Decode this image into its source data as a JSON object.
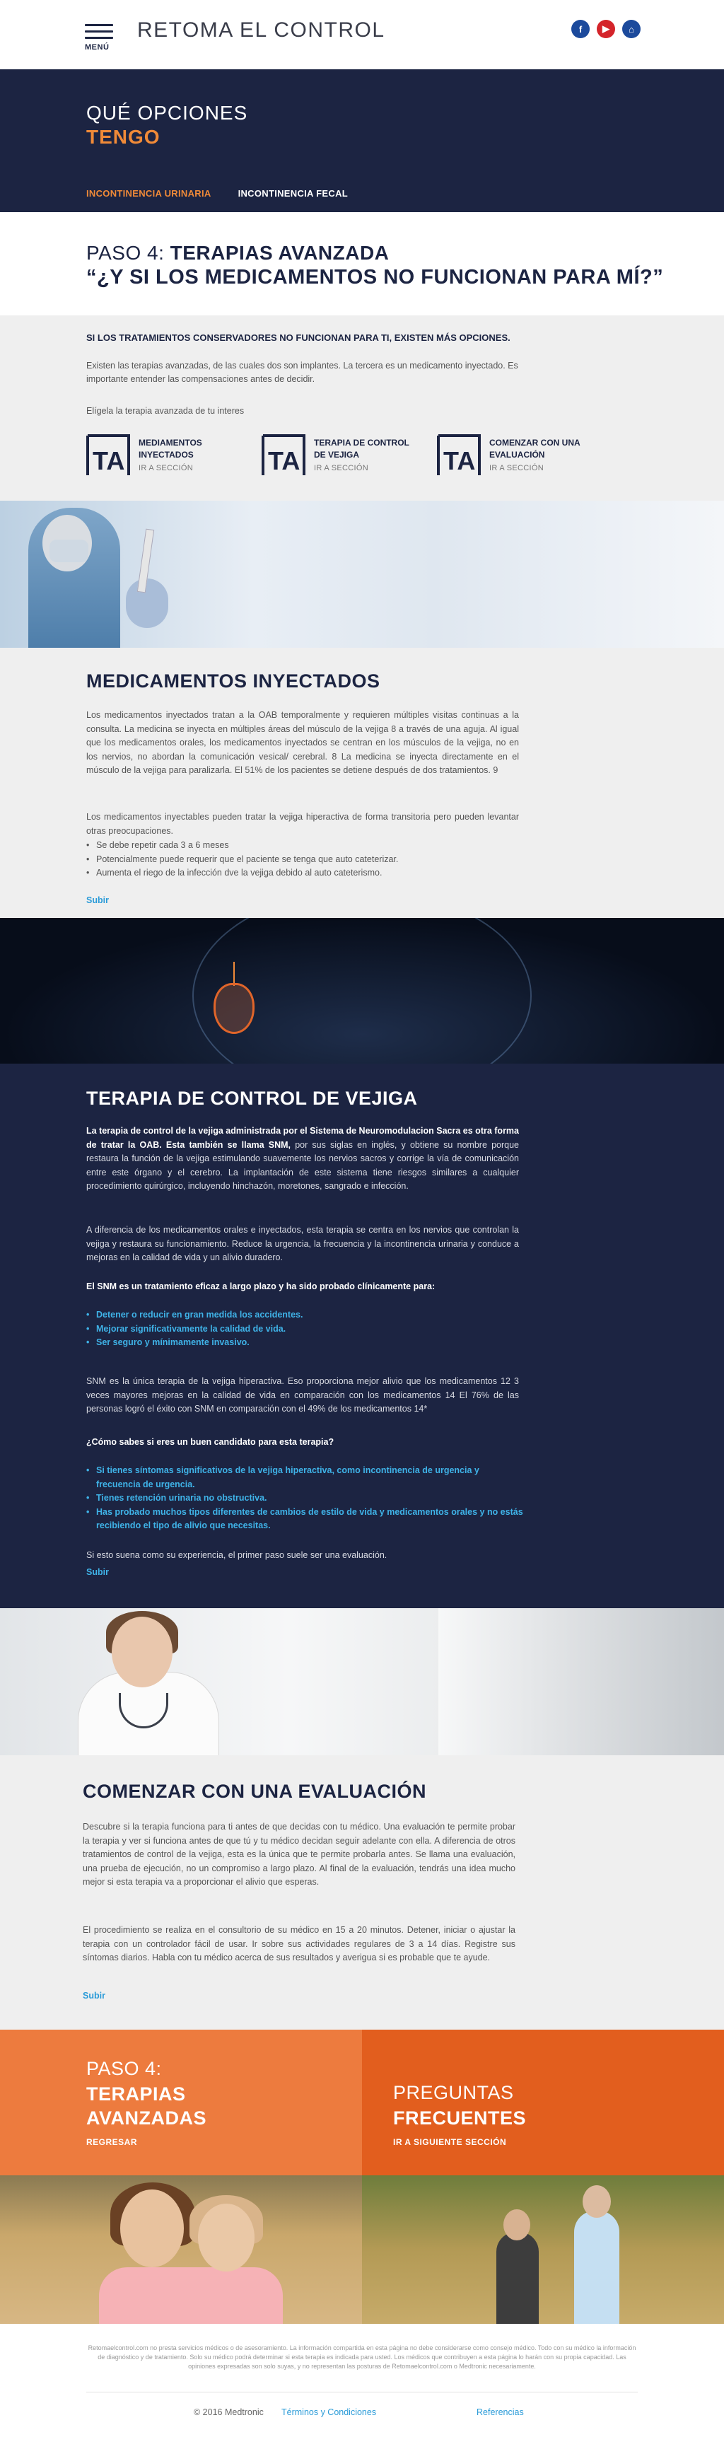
{
  "header": {
    "menu_label": "MENÚ",
    "site_title": "RETOMA EL CONTROL",
    "social": [
      {
        "icon": "facebook-icon",
        "glyph": "f"
      },
      {
        "icon": "youtube-icon",
        "glyph": "▶"
      },
      {
        "icon": "home-icon",
        "glyph": "⌂"
      }
    ]
  },
  "hero": {
    "line1": "QUÉ OPCIONES",
    "line2": "TENGO",
    "tabs": [
      {
        "label": "INCONTINENCIA URINARIA",
        "active": true
      },
      {
        "label": "INCONTINENCIA FECAL",
        "active": false
      }
    ]
  },
  "step": {
    "prefix": "PASO 4:",
    "title": "TERAPIAS AVANZADA",
    "question": "“¿Y SI LOS MEDICAMENTOS NO FUNCIONAN PARA MÍ?”"
  },
  "intro": {
    "heading": "SI LOS TRATAMIENTOS CONSERVADORES NO FUNCIONAN PARA TI, EXISTEN MÁS OPCIONES.",
    "body": "Existen las terapias avanzadas, de las cuales dos son implantes. La tercera es un medicamento inyectado. Es importante entender las compensaciones antes de decidir.",
    "pick": "Elígela la terapia avanzada de tu interes",
    "options": [
      {
        "logo": "TA",
        "title": "MEDIAMENTOS INYECTADOS",
        "link": "IR A SECCIÓN"
      },
      {
        "logo": "TA",
        "title": "TERAPIA DE CONTROL DE VEJIGA",
        "link": "IR A SECCIÓN"
      },
      {
        "logo": "TA",
        "title": "COMENZAR CON UNA EVALUACIÓN",
        "link": "IR A SECCIÓN"
      }
    ]
  },
  "med": {
    "title": "MEDICAMENTOS INYECTADOS",
    "p1": "Los medicamentos inyectados tratan a la OAB temporalmente y requieren múltiples visitas continuas a la consulta. La medicina se inyecta en múltiples áreas del músculo de la vejiga 8 a través de una aguja. Al igual que los medicamentos orales, los medicamentos inyectados se centran en los músculos de la vejiga, no en los nervios, no abordan la comunicación vesical/ cerebral. 8 La medicina se inyecta directamente en el músculo de la vejiga para paralizarla. El 51% de los pacientes se detiene después de dos tratamientos. 9",
    "p2": "Los medicamentos inyectables pueden tratar la vejiga hiperactiva de forma transitoria pero pueden levantar otras preocupaciones.",
    "bullets": [
      "Se debe repetir cada 3 a 6 meses",
      "Potencialmente puede requerir que el paciente se tenga que auto cateterizar.",
      "Aumenta el riego de la infección dve la vejiga debido al auto cateterismo."
    ],
    "up": "Subir"
  },
  "snm": {
    "title": "TERAPIA DE CONTROL DE VEJIGA",
    "p1_bold": "La terapia de control de la vejiga administrada por el Sistema de Neuromodulacion Sacra es otra forma de tratar la OAB. Esta también se llama SNM,",
    "p1_rest": " por sus siglas en inglés, y obtiene su nombre porque restaura la función de la vejiga estimulando suavemente los nervios sacros y corrige la vía de comunicación entre este órgano y el cerebro. La implantación de este sistema tiene riesgos similares a cualquier procedimiento quirúrgico, incluyendo hinchazón, moretones, sangrado e infección.",
    "p2": "A diferencia de los medicamentos orales e inyectados, esta terapia se centra en los nervios que controlan la vejiga y restaura su funcionamiento. Reduce la urgencia, la frecuencia y la incontinencia urinaria y conduce a mejoras en la calidad de vida y un alivio duradero.",
    "p3": "El SNM es un tratamiento eficaz a largo plazo y ha sido probado clínicamente para:",
    "list1": [
      "Detener o reducir en gran medida los accidentes.",
      "Mejorar significativamente la calidad de vida.",
      "Ser seguro y mínimamente invasivo."
    ],
    "p4": "SNM es la única terapia de la vejiga hiperactiva. Eso proporciona mejor alivio que los medicamentos 12 3 veces mayores mejoras en la calidad de vida en comparación con los medicamentos 14 El 76% de las personas logró el éxito con SNM en comparación con el 49% de los medicamentos 14*",
    "p5": "¿Cómo sabes si eres un buen candidato para esta terapia?",
    "list2": [
      "Si tienes síntomas significativos de la vejiga hiperactiva, como incontinencia de urgencia y frecuencia de urgencia.",
      "Tienes retención urinaria no obstructiva.",
      "Has probado muchos tipos diferentes de cambios de estilo de vida y medicamentos orales y no estás recibiendo el tipo de alivio que necesitas."
    ],
    "p6": "Si esto suena como su experiencia, el primer paso suele ser una evaluación.",
    "up": "Subir"
  },
  "eval": {
    "title": "COMENZAR CON UNA EVALUACIÓN",
    "p1": "Descubre si la terapia funciona para ti antes de que decidas con tu médico. Una evaluación te permite probar la terapia y ver si funciona antes de que tú y tu médico decidan seguir adelante con ella. A diferencia de otros tratamientos de control de la vejiga, esta es la única que te permite probarla antes. Se llama una evaluación, una prueba de ejecución, no un compromiso a largo plazo. Al final de la evaluación, tendrás una idea mucho mejor si esta terapia va a proporcionar el alivio que esperas.",
    "p2": "El procedimiento se realiza en el consultorio de su médico en 15 a 20 minutos. Detener, iniciar o ajustar la terapia con un controlador fácil de usar. Ir sobre sus actividades regulares de 3 a 14 días. Registre sus síntomas diarios. Habla con tu médico acerca de sus resultados y averigua si es probable que te ayude.",
    "up": "Subir"
  },
  "navblocks": {
    "prev": {
      "kicker": "PASO 4:",
      "title_1": "TERAPIAS",
      "title_2": "AVANZADAS",
      "sub": "REGRESAR"
    },
    "next": {
      "kicker": "PREGUNTAS",
      "title_1": "FRECUENTES",
      "sub": "IR A SIGUIENTE SECCIÓN"
    }
  },
  "footer": {
    "disclaimer": "Retomaelcontrol.com no presta servicios médicos o de asesoramiento. La información compartida en esta página no debe considerarse como consejo médico. Todo con su médico la información de diagnóstico y de tratamiento. Solo su médico podrá determinar si esta terapia es indicada para usted. Los médicos que contribuyen a esta página lo harán con su propia capacidad. Las opiniones expresadas son solo suyas, y no representan las posturas de Retomaelcontrol.com o Medtronic necesariamente.",
    "copyright": "© 2016 Medtronic",
    "terms": "Términos y Condiciones",
    "refs": "Referencias"
  },
  "colors": {
    "navy": "#1c2442",
    "orange": "#f08a38",
    "orange_dark": "#e25e1e",
    "link_blue": "#2a9bd8",
    "light_bg": "#efefef"
  }
}
